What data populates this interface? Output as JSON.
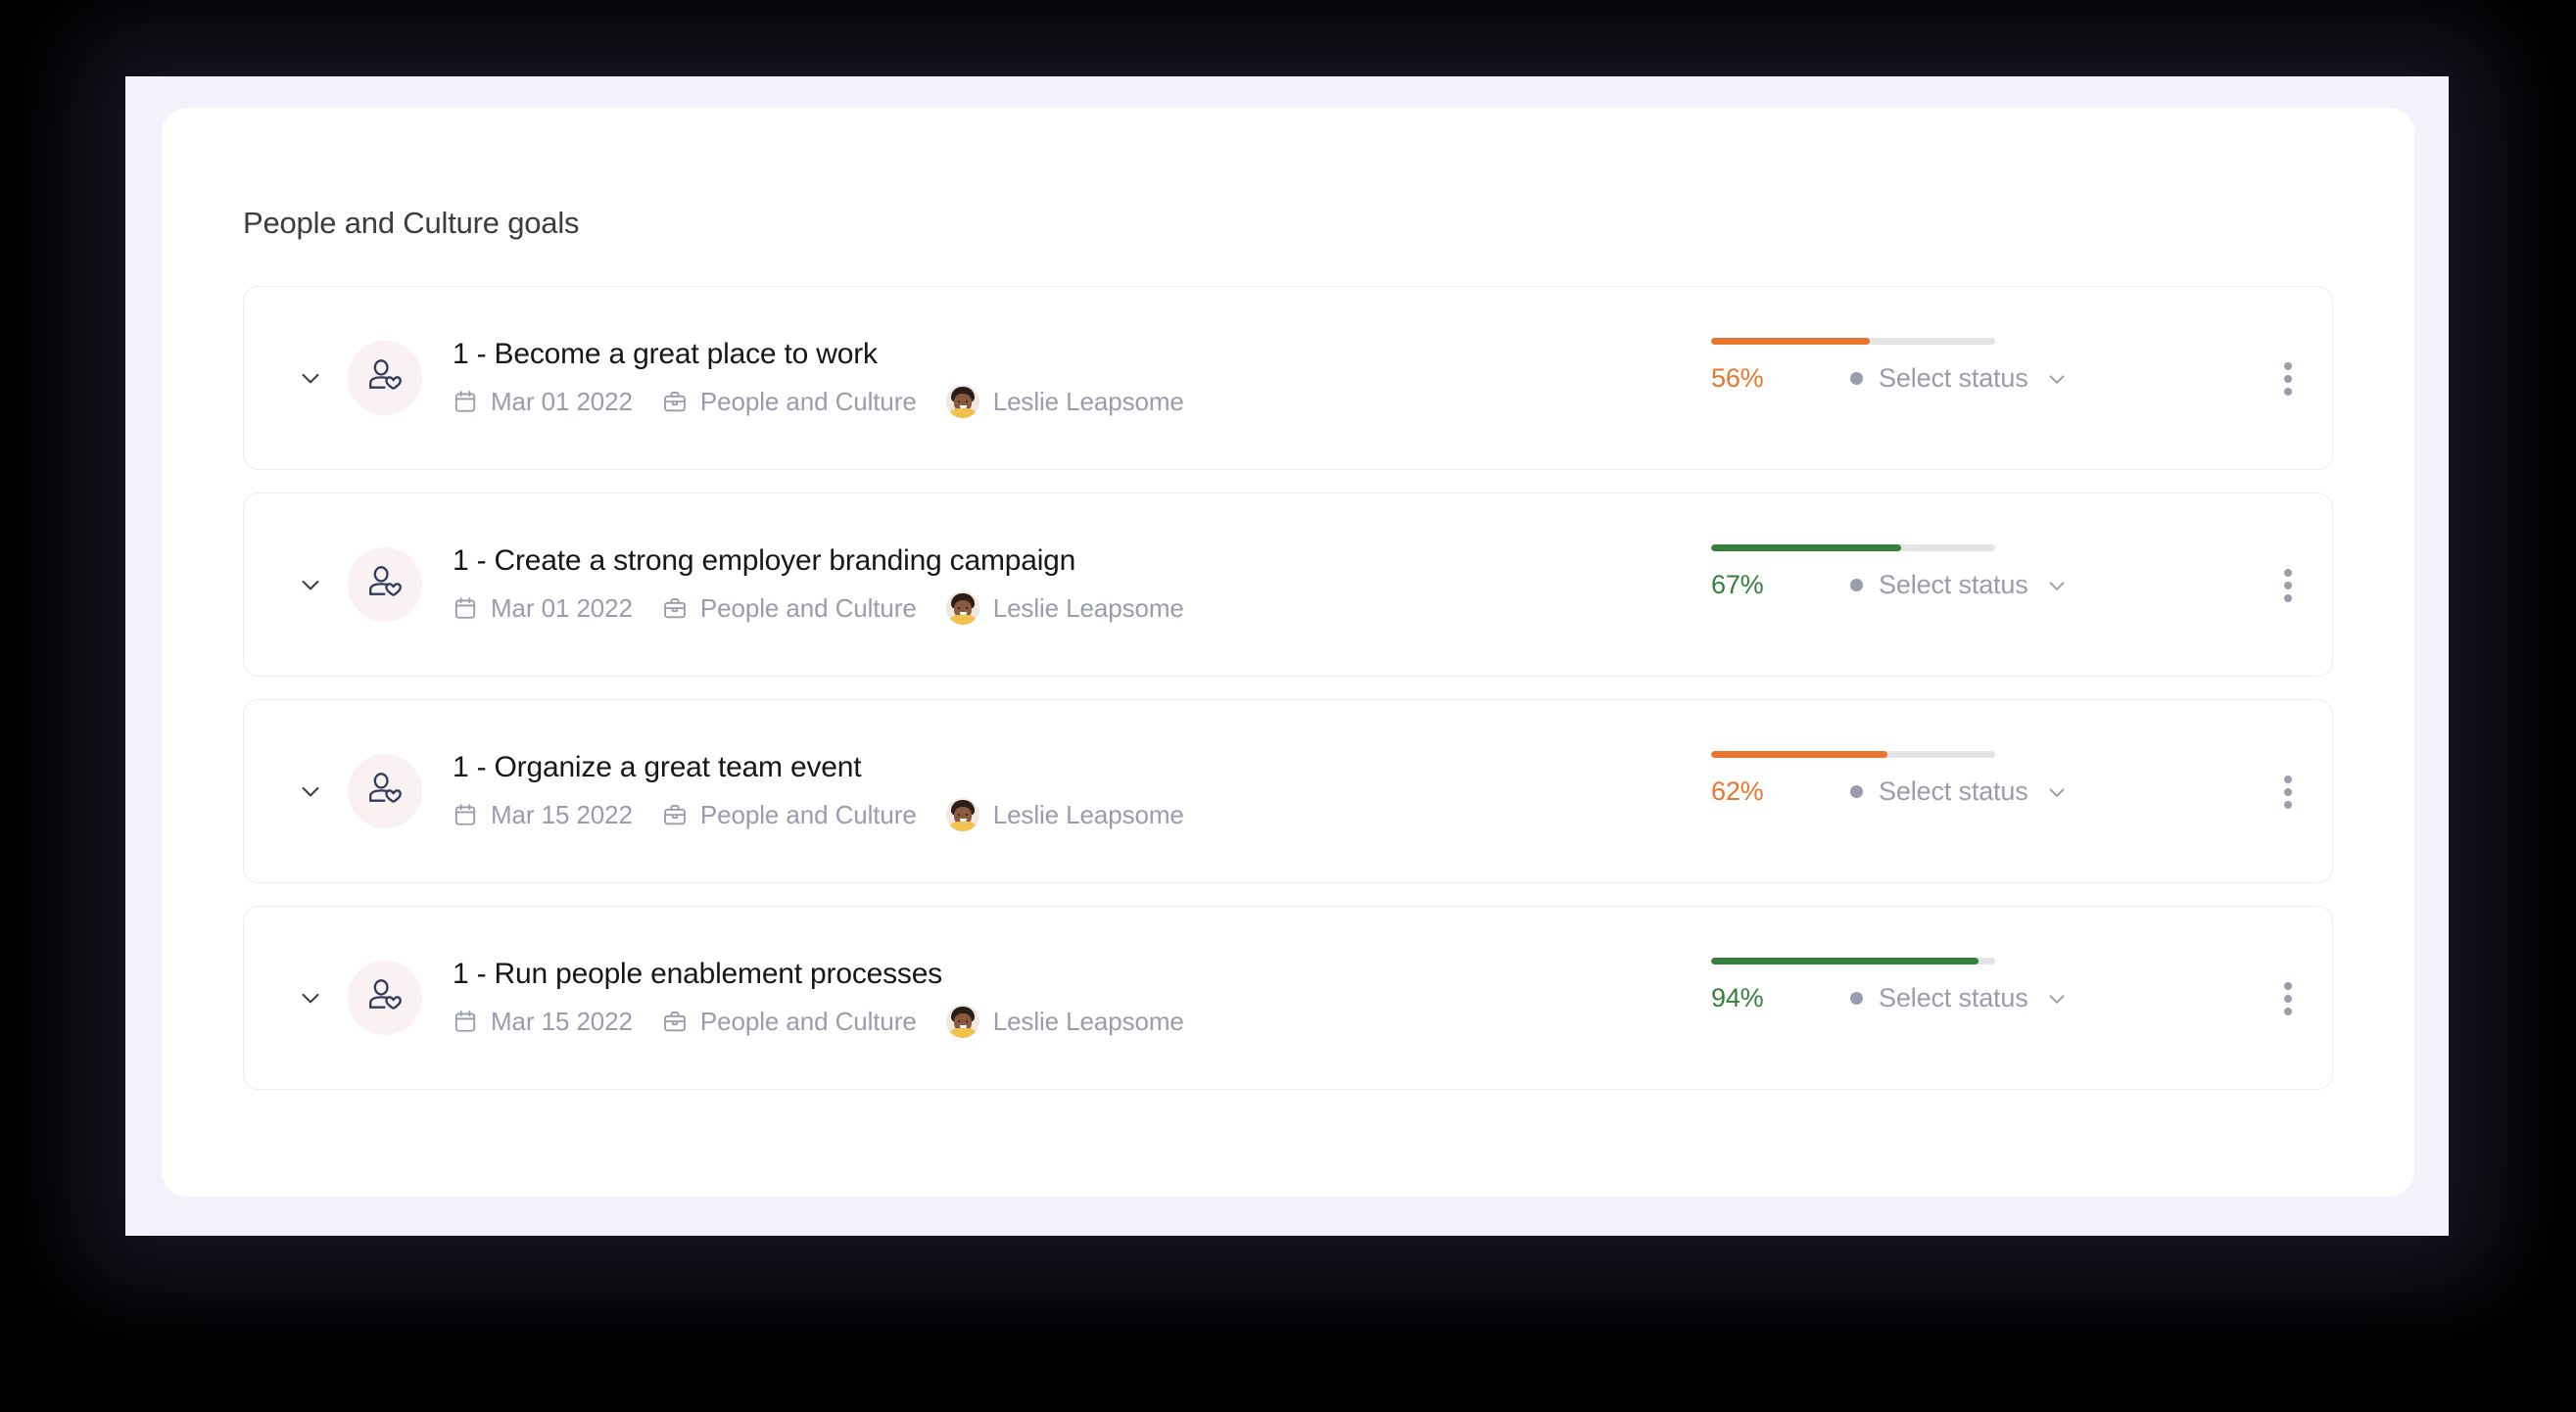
{
  "panel": {
    "title": "People and Culture goals"
  },
  "icons": {
    "chevron_toggle": "chevron-down-icon",
    "goal_type": "person-heart-icon",
    "date": "calendar-icon",
    "team": "briefcase-icon",
    "owner": "avatar-icon",
    "status_caret": "chevron-down-icon",
    "overflow": "more-vertical-icon"
  },
  "colors": {
    "progress_orange": "#E8762C",
    "progress_green": "#357F3C",
    "progress_track": "#E4E4E7",
    "status_dot": "#9A9CAD",
    "badge_bg": "#FAF1F2",
    "badge_stroke": "#313B5C",
    "page_bg": "#F2F2FB",
    "panel_bg": "#FFFFFF",
    "card_border": "#EDEDF2",
    "title_text": "#3C3C3C",
    "meta_text": "#9A9CAD"
  },
  "status": {
    "placeholder": "Select status"
  },
  "goals": [
    {
      "title": "1 - Become a great place to work",
      "date": "Mar 01 2022",
      "team": "People and Culture",
      "owner": "Leslie Leapsome",
      "progress": 56,
      "progress_label": "56%",
      "progress_color": "#E8762C",
      "status": "Select status"
    },
    {
      "title": "1 - Create a strong employer branding campaign",
      "date": "Mar 01 2022",
      "team": "People and Culture",
      "owner": "Leslie Leapsome",
      "progress": 67,
      "progress_label": "67%",
      "progress_color": "#357F3C",
      "status": "Select status"
    },
    {
      "title": "1 - Organize a great team event",
      "date": "Mar 15 2022",
      "team": "People and Culture",
      "owner": "Leslie Leapsome",
      "progress": 62,
      "progress_label": "62%",
      "progress_color": "#E8762C",
      "status": "Select status"
    },
    {
      "title": "1 - Run people enablement processes",
      "date": "Mar 15 2022",
      "team": "People and Culture",
      "owner": "Leslie Leapsome",
      "progress": 94,
      "progress_label": "94%",
      "progress_color": "#357F3C",
      "status": "Select status"
    }
  ]
}
